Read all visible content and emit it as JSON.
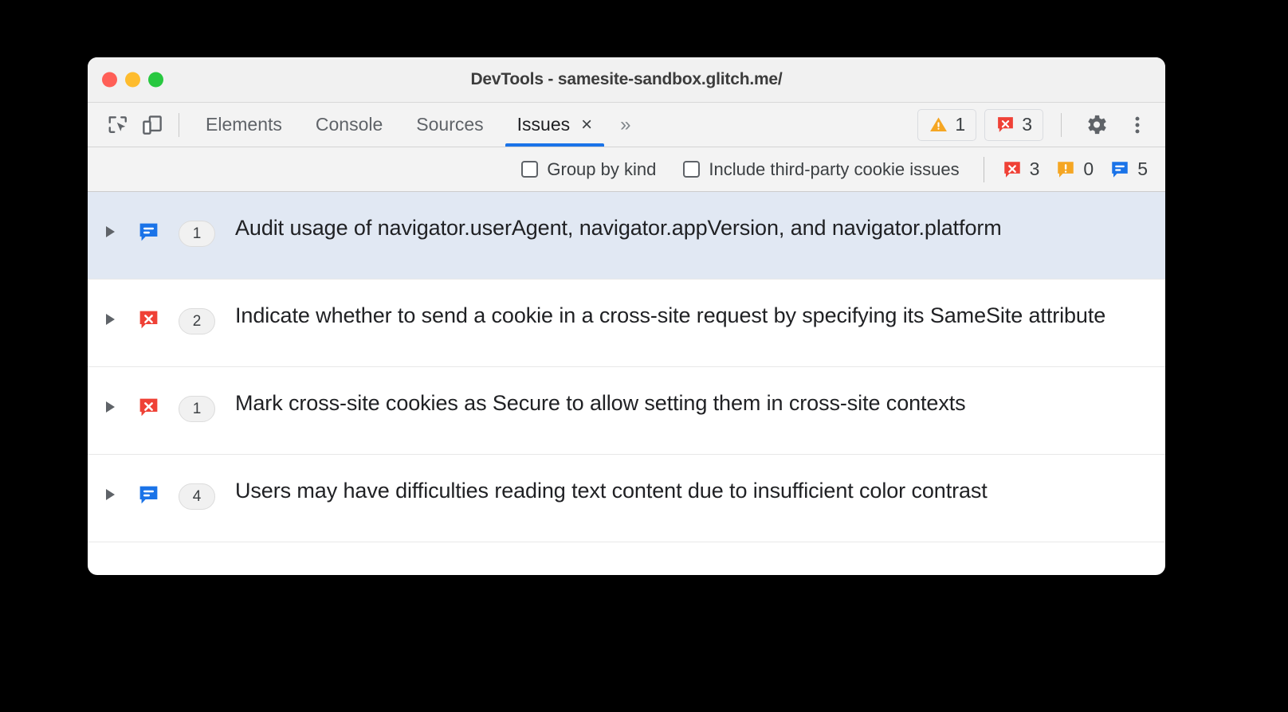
{
  "window": {
    "title": "DevTools - samesite-sandbox.glitch.me/",
    "traffic_lights": [
      "close-red",
      "minimize-yellow",
      "maximize-green"
    ]
  },
  "toolbar": {
    "inspect_icon": "inspect-element-icon",
    "device_icon": "device-toolbar-icon",
    "settings_icon": "gear-icon",
    "more_icon": "more-vertical-icon",
    "warning_chip": {
      "icon": "warning-triangle-icon",
      "count": "1"
    },
    "error_chip": {
      "icon": "error-bubble-icon",
      "count": "3"
    }
  },
  "tabs": [
    {
      "label": "Elements",
      "active": false
    },
    {
      "label": "Console",
      "active": false
    },
    {
      "label": "Sources",
      "active": false
    },
    {
      "label": "Issues",
      "active": true,
      "close": "×"
    }
  ],
  "more_tabs_label": "»",
  "filters": {
    "group_by_kind": {
      "label": "Group by kind",
      "checked": false
    },
    "include_third_party": {
      "label": "Include third-party cookie issues",
      "checked": false
    },
    "severity_counts": [
      {
        "icon": "error-bubble-icon",
        "kind": "error",
        "count": "3",
        "color": "#ef4136"
      },
      {
        "icon": "warning-bubble-icon",
        "kind": "warning",
        "count": "0",
        "color": "#f5a623"
      },
      {
        "icon": "info-bubble-icon",
        "kind": "info",
        "count": "5",
        "color": "#1a73e8"
      }
    ]
  },
  "issues": [
    {
      "icon": "info-bubble-icon",
      "severity": "info",
      "count": "1",
      "title": "Audit usage of navigator.userAgent, navigator.appVersion, and navigator.platform",
      "selected": true
    },
    {
      "icon": "error-bubble-icon",
      "severity": "error",
      "count": "2",
      "title": "Indicate whether to send a cookie in a cross-site request by specifying its SameSite attribute",
      "selected": false
    },
    {
      "icon": "error-bubble-icon",
      "severity": "error",
      "count": "1",
      "title": "Mark cross-site cookies as Secure to allow setting them in cross-site contexts",
      "selected": false
    },
    {
      "icon": "info-bubble-icon",
      "severity": "info",
      "count": "4",
      "title": "Users may have difficulties reading text content due to insufficient color contrast",
      "selected": false
    }
  ],
  "colors": {
    "accent": "#1a73e8",
    "error": "#ef4136",
    "warning": "#f5a623",
    "selected_row": "#e1e8f3",
    "titlebar": "#f1f1f1"
  }
}
